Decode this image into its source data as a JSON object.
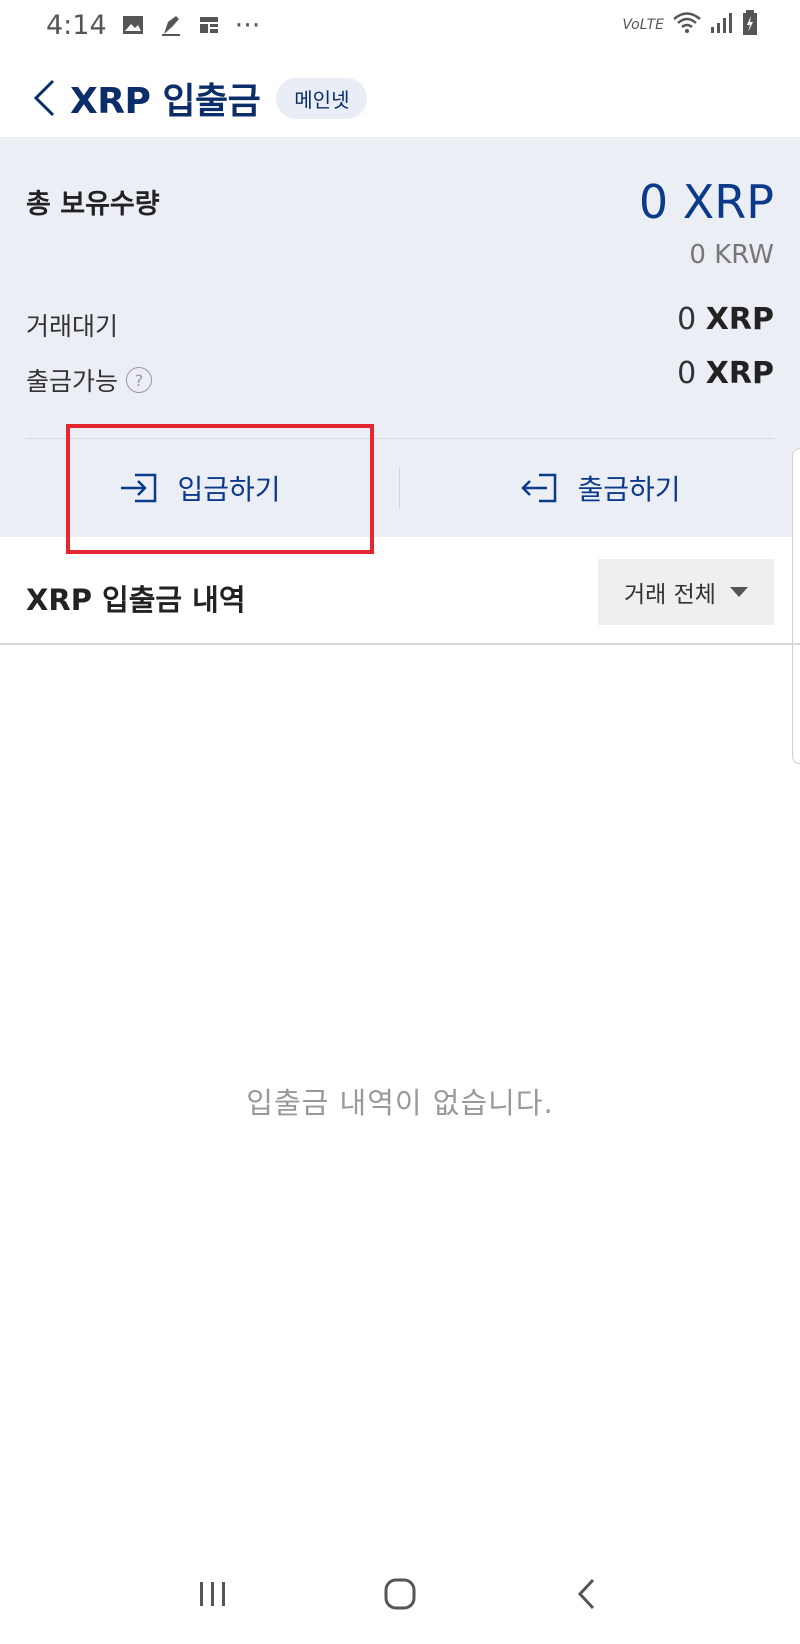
{
  "status_bar": {
    "time": "4:14",
    "more": "···",
    "network": "VoLTE"
  },
  "header": {
    "title": "XRP 입출금",
    "network_badge": "메인넷"
  },
  "summary": {
    "total_label": "총 보유수량",
    "total_value": "0 XRP",
    "total_krw": "0 KRW",
    "pending_label": "거래대기",
    "pending_amount": "0",
    "pending_unit": "XRP",
    "available_label": "출금가능",
    "available_amount": "0",
    "available_unit": "XRP"
  },
  "actions": {
    "deposit_label": "입금하기",
    "withdraw_label": "출금하기"
  },
  "history": {
    "title": "XRP 입출금 내역",
    "filter_label": "거래 전체",
    "empty_message": "입출금 내역이 없습니다."
  },
  "colors": {
    "brand": "#0b2e6b",
    "highlight": "#e3262f",
    "summary_bg": "#eceef5"
  }
}
